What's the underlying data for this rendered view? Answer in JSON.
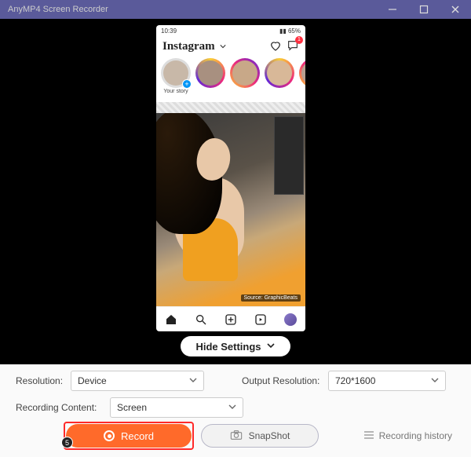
{
  "window": {
    "title": "AnyMP4 Screen Recorder"
  },
  "phone": {
    "status_time": "10:39",
    "ig_logo": "Instagram",
    "msg_badge": "1",
    "stories": {
      "own_label": "Your story",
      "s2_label": "",
      "s3_label": "",
      "s4_label": "",
      "s5_label": ""
    },
    "caption": "Source: GraphicBeats"
  },
  "hide_settings": "Hide Settings",
  "settings": {
    "resolution_label": "Resolution:",
    "resolution_value": "Device",
    "output_label": "Output Resolution:",
    "output_value": "720*1600",
    "content_label": "Recording Content:",
    "content_value": "Screen"
  },
  "actions": {
    "step_badge": "5",
    "record": "Record",
    "snapshot": "SnapShot",
    "history": "Recording history"
  }
}
